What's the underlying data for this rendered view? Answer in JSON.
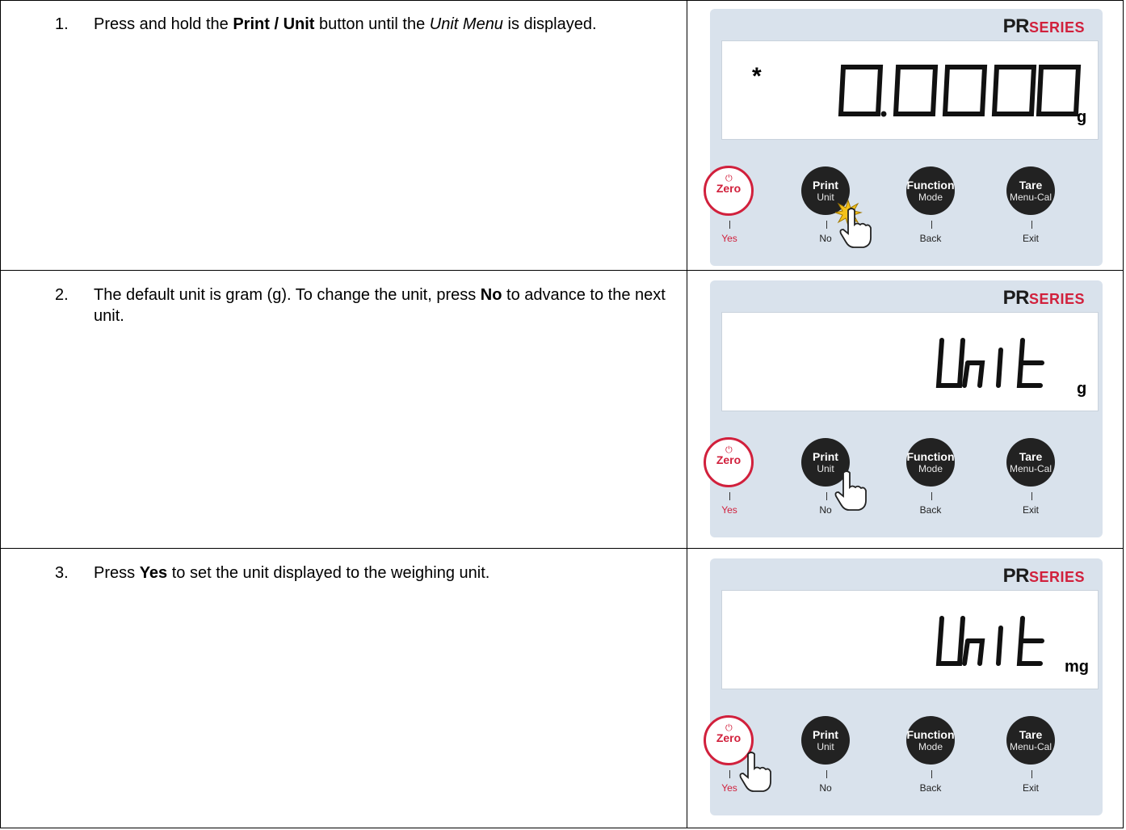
{
  "brand": {
    "main": "PR",
    "small": "SERIES"
  },
  "steps": [
    {
      "number": "1.",
      "text_parts": [
        "Press and hold the ",
        "Print / Unit",
        " button until the ",
        "Unit Menu",
        " is displayed."
      ],
      "display_star": "*",
      "display_unit": "g"
    },
    {
      "number": "2.",
      "text_parts": [
        "The default unit is gram (g). To change the unit, press ",
        "No",
        " to advance to the next unit."
      ],
      "display_unit": "g"
    },
    {
      "number": "3.",
      "text_parts": [
        "Press ",
        "Yes",
        " to set the unit displayed to the weighing unit."
      ],
      "display_unit": "mg"
    }
  ],
  "buttons": {
    "zero": {
      "label": "Zero",
      "sub": "Yes"
    },
    "print": {
      "label": "Print",
      "label2": "Unit",
      "sub": "No"
    },
    "function": {
      "label": "Function",
      "label2": "Mode",
      "sub": "Back"
    },
    "tare": {
      "label": "Tare",
      "label2": "Menu-Cal",
      "sub": "Exit"
    }
  },
  "colors": {
    "accent_red": "#d1203c",
    "panel_bg": "#d9e2ec",
    "button_dark": "#222222"
  },
  "icons": [
    "power-icon",
    "hand-pointer-icon",
    "press-burst-icon"
  ]
}
